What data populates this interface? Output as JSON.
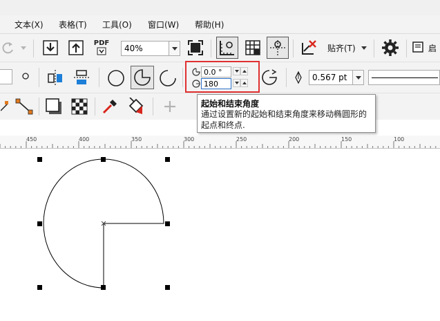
{
  "menu": {
    "items": [
      "文本(X)",
      "表格(T)",
      "工具(O)",
      "窗口(W)",
      "帮助(H)"
    ]
  },
  "toolbar": {
    "pdf_label": "PDF",
    "zoom_value": "40%",
    "snap_label": "贴齐(T)",
    "launch_label": "启"
  },
  "properties": {
    "start_angle": "0.0 °",
    "end_angle": "180",
    "outline_width": "0.567 pt"
  },
  "tooltip": {
    "title": "起始和结束角度",
    "text": "通过设置新的起始和结束角度来移动椭圆形的起点和终点."
  },
  "ruler": {
    "labels": [
      "450",
      "400",
      "350",
      "300",
      "250",
      "200",
      "150",
      "100"
    ]
  },
  "colors": {
    "highlight_border": "#e03030",
    "icon_blue": "#1e7fd8",
    "icon_orange": "#e07a1f",
    "icon_red": "#d9261c"
  }
}
